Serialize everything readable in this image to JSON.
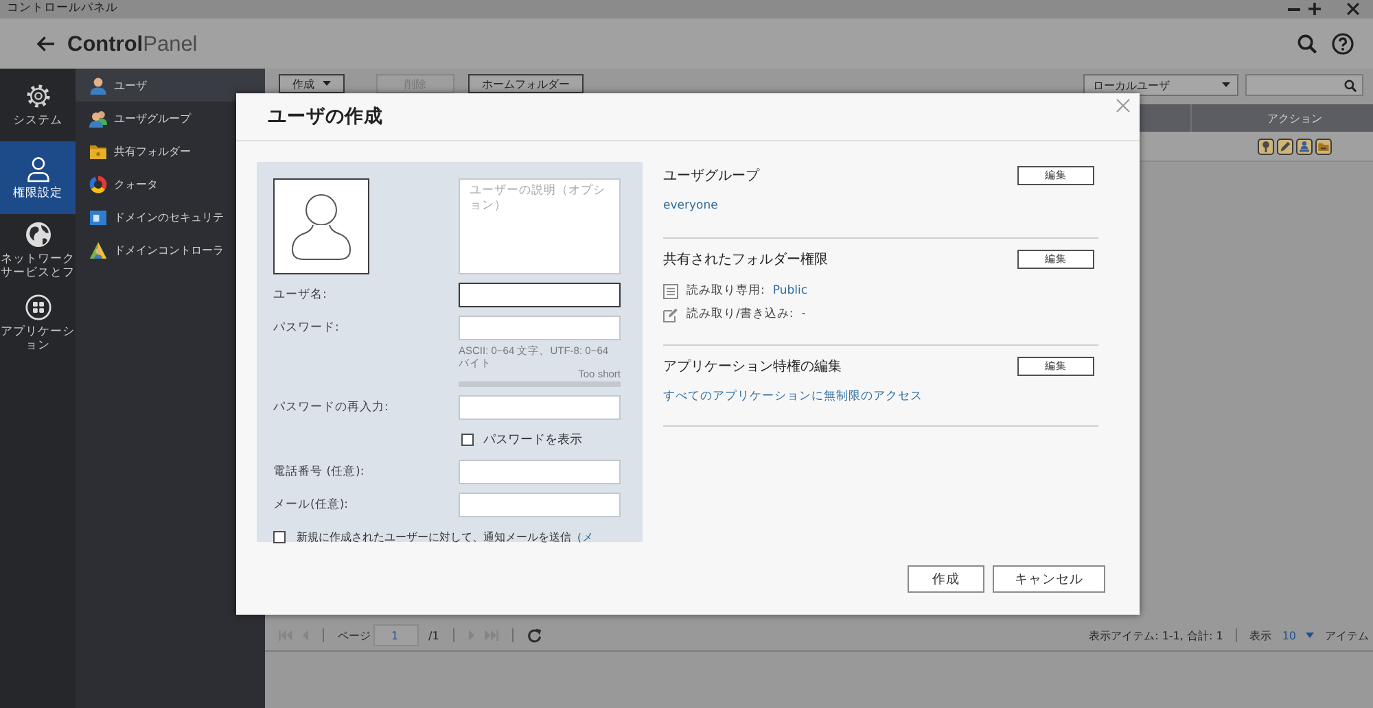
{
  "window": {
    "title": "コントロールパネル"
  },
  "header": {
    "title": "**Control**Panel"
  },
  "nav": {
    "items": [
      {
        "label": "システム",
        "selected": false
      },
      {
        "label": "権限設定",
        "selected": true
      },
      {
        "label": "ネットワークサービスとフ",
        "selected": false
      },
      {
        "label": "アプリケーション",
        "selected": false
      }
    ]
  },
  "subnav": {
    "items": [
      {
        "label": "ユーザ",
        "selected": true
      },
      {
        "label": "ユーザグループ",
        "selected": false
      },
      {
        "label": "共有フォルダー",
        "selected": false
      },
      {
        "label": "クォータ",
        "selected": false
      },
      {
        "label": "ドメインのセキュリテ",
        "selected": false
      },
      {
        "label": "ドメインコントローラ",
        "selected": false
      }
    ]
  },
  "toolbar": {
    "buttons": [
      {
        "label": "作成",
        "dropdown": true,
        "disabled": false
      },
      {
        "label": "削除",
        "dropdown": false,
        "disabled": true
      },
      {
        "label": "ホームフォルダー",
        "dropdown": false,
        "disabled": false
      }
    ],
    "filter": {
      "value": "ローカルユーザ"
    }
  },
  "table": {
    "columns": [
      {
        "label": "アクション"
      }
    ]
  },
  "pagination": {
    "page_label": "ページ",
    "page": "1",
    "total": "/1",
    "summary": "表示アイテム: 1-1, 合計: 1",
    "show_label": "表示",
    "per_page": "10",
    "items_label": "アイテム"
  },
  "dialog": {
    "title": "ユーザの作成",
    "description": {
      "placeholder": "ユーザーの説明（オプション）"
    },
    "form": [
      {
        "kind": "input",
        "label": "ユーザ名:",
        "focused": true
      },
      {
        "kind": "input",
        "label": "パスワード:",
        "focused": false
      },
      {
        "kind": "hint",
        "text": "ASCII: 0~64 文字、UTF-8: 0~64 バイト",
        "strength": "Too short"
      },
      {
        "kind": "input",
        "label": "パスワードの再入力:",
        "focused": false
      },
      {
        "kind": "checkbox",
        "label": "パスワードを表示",
        "checked": false
      },
      {
        "kind": "input",
        "label": "電話番号 (任意):",
        "focused": false
      },
      {
        "kind": "input",
        "label": "メール(任意):",
        "focused": false
      }
    ],
    "notify": {
      "label": "新規に作成されたユーザーに対して、通知メールを送信（",
      "link": "メ",
      "checked": false
    },
    "sections": [
      {
        "kind": "link",
        "title": "ユーザグループ",
        "button": "編集",
        "link": "everyone"
      },
      {
        "kind": "permissions",
        "title": "共有されたフォルダー権限",
        "button": "編集",
        "permissions": [
          {
            "label": "読み取り専用:",
            "value": "Public",
            "link": true
          },
          {
            "label": "読み取り/書き込み:",
            "value": "-",
            "link": false
          }
        ]
      },
      {
        "kind": "link",
        "title": "アプリケーション特権の編集",
        "button": "編集",
        "link": "すべてのアプリケーションに無制限のアクセス"
      }
    ],
    "buttons": [
      {
        "label": "作成"
      },
      {
        "label": "キャンセル"
      }
    ]
  }
}
